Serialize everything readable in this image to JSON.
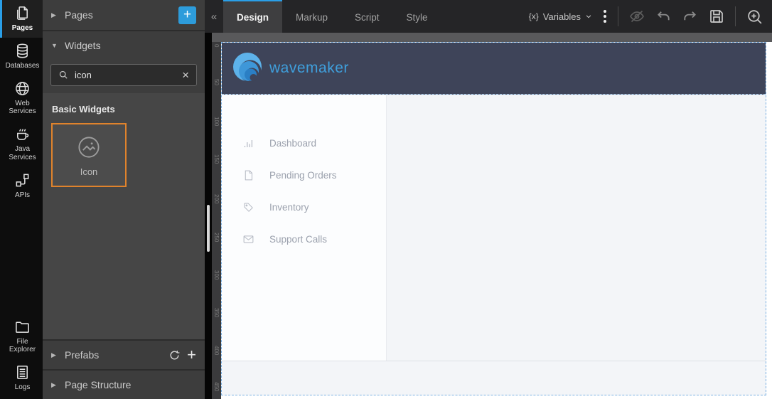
{
  "activity_bar": {
    "items": [
      {
        "label": "Pages",
        "active": true
      },
      {
        "label": "Databases",
        "active": false
      },
      {
        "label": "Web Services",
        "active": false
      },
      {
        "label": "Java Services",
        "active": false
      },
      {
        "label": "APIs",
        "active": false
      },
      {
        "label": "File Explorer",
        "active": false
      },
      {
        "label": "Logs",
        "active": false
      }
    ]
  },
  "panel": {
    "pages_header": {
      "label": "Pages"
    },
    "widgets_header": {
      "label": "Widgets"
    },
    "search": {
      "value": "icon"
    },
    "basic_widgets_title": "Basic Widgets",
    "widget_items": [
      {
        "label": "Icon"
      }
    ],
    "prefabs_header": {
      "label": "Prefabs"
    },
    "page_structure_header": {
      "label": "Page Structure"
    }
  },
  "icons": {
    "caret_right": "▶",
    "caret_down": "▼",
    "add": "+",
    "collapse": "«",
    "clear": "×"
  },
  "toolbar": {
    "tabs": [
      {
        "label": "Design",
        "active": true
      },
      {
        "label": "Markup",
        "active": false
      },
      {
        "label": "Script",
        "active": false
      },
      {
        "label": "Style",
        "active": false
      }
    ],
    "variables": {
      "prefix": "{x}",
      "label": "Variables"
    }
  },
  "ruler": {
    "v_labels": [
      "0",
      "50",
      "100",
      "150",
      "200",
      "250",
      "300",
      "350",
      "400",
      "450"
    ]
  },
  "app": {
    "brand": "wavemaker",
    "nav": [
      {
        "label": "Dashboard"
      },
      {
        "label": "Pending Orders"
      },
      {
        "label": "Inventory"
      },
      {
        "label": "Support Calls"
      }
    ]
  },
  "colors": {
    "accent_blue": "#2d9cdb",
    "active_tab_blue": "#2a9fe8",
    "selection_orange": "#e0832c",
    "brand_blue": "#3f9fdc",
    "app_header_bg": "#3e4459"
  }
}
